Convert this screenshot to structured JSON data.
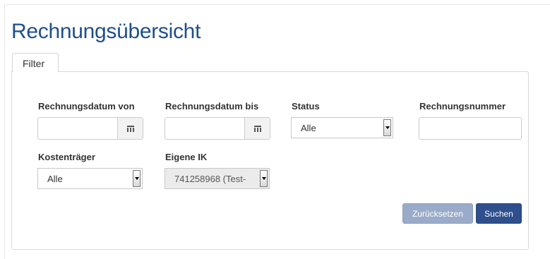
{
  "page": {
    "title": "Rechnungsübersicht"
  },
  "tabs": [
    {
      "label": "Filter"
    }
  ],
  "filter": {
    "date_from": {
      "label": "Rechnungsdatum von",
      "value": ""
    },
    "date_to": {
      "label": "Rechnungsdatum bis",
      "value": ""
    },
    "status": {
      "label": "Status",
      "selected": "Alle"
    },
    "invoice_number": {
      "label": "Rechnungsnummer",
      "value": ""
    },
    "payer": {
      "label": "Kostenträger",
      "selected": "Alle"
    },
    "own_ik": {
      "label": "Eigene IK",
      "selected": "741258968 (Test-"
    }
  },
  "buttons": {
    "reset_label": "Zurücksetzen",
    "search_label": "Suchen"
  },
  "colors": {
    "title": "#1f4f8c",
    "primary": "#2e4f8c",
    "primary_disabled": "#9aabc9"
  },
  "icons": {
    "date_picker": "calendar-icon",
    "select": "chevron-down-icon"
  }
}
